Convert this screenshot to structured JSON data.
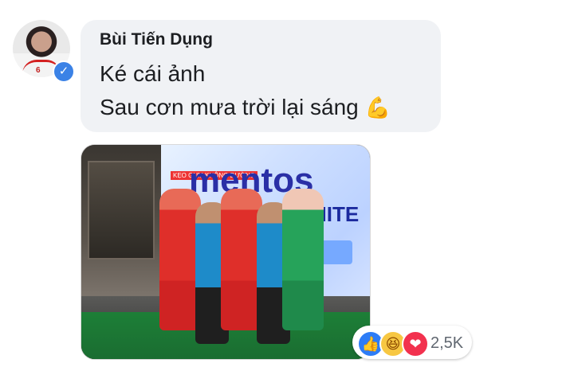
{
  "comment": {
    "author": "Bùi Tiến Dụng",
    "text_line1": "Ké cái ảnh",
    "text_line2": "Sau cơn mưa trời lại sáng",
    "emoji_icon": "flexed-biceps-icon"
  },
  "avatar": {
    "verified_icon": "check-icon",
    "jersey_number": "6"
  },
  "photo": {
    "brand": "mentos",
    "banner_tag": "KẸO GUM KHÔNG ĐƯỜNG",
    "banner_word": "PURE WHITE"
  },
  "reactions": {
    "icons": [
      "like-icon",
      "haha-icon",
      "love-icon"
    ],
    "count": "2,5K"
  }
}
